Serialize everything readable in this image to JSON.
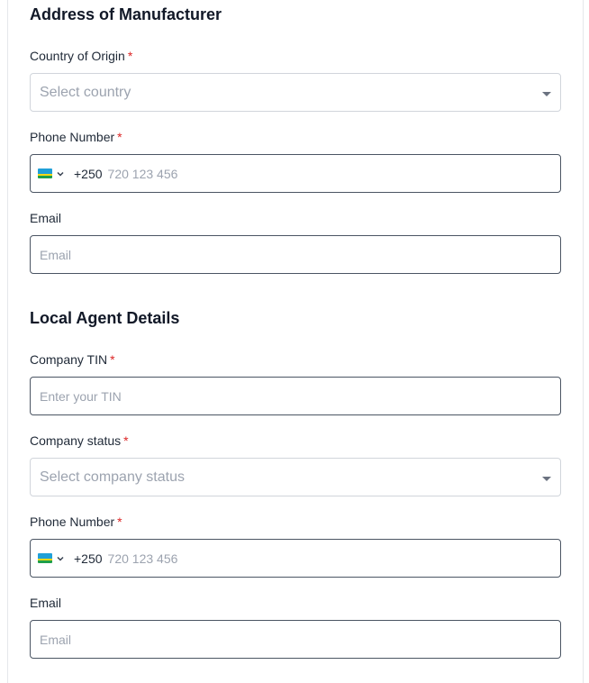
{
  "manufacturer": {
    "title": "Address of Manufacturer",
    "country": {
      "label": "Country of Origin",
      "required": "*",
      "placeholder": "Select country"
    },
    "phone": {
      "label": "Phone Number",
      "required": "*",
      "dial_code": "+250",
      "placeholder": "720 123 456",
      "flag": "rwanda-flag"
    },
    "email": {
      "label": "Email",
      "placeholder": "Email"
    }
  },
  "agent": {
    "title": "Local Agent Details",
    "tin": {
      "label": "Company TIN",
      "required": "*",
      "placeholder": "Enter your TIN"
    },
    "status": {
      "label": "Company status",
      "required": "*",
      "placeholder": "Select company status"
    },
    "phone": {
      "label": "Phone Number",
      "required": "*",
      "dial_code": "+250",
      "placeholder": "720 123 456",
      "flag": "rwanda-flag"
    },
    "email": {
      "label": "Email",
      "placeholder": "Email"
    }
  },
  "colors": {
    "required": "#dc2626",
    "placeholder": "#9ca3af",
    "border": "#4b5563"
  }
}
